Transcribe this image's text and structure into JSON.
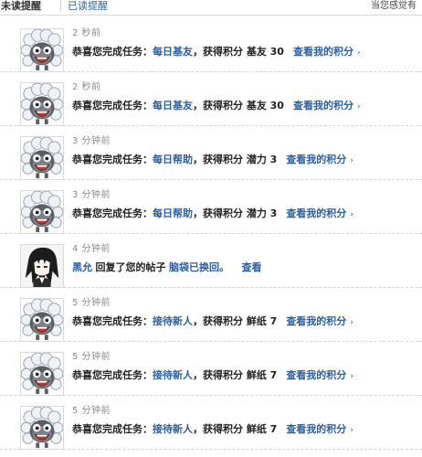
{
  "tabs": {
    "unread_label": "未读提醒",
    "read_label": "已读提醒"
  },
  "top_right_text": "当您感觉有",
  "notifications": [
    {
      "time": "2 秒前",
      "prefix": "恭喜您完成任务：",
      "task": "每日基友",
      "middle": "，获得积分 基友 30",
      "action": "查看我的积分",
      "arrow": "›",
      "avatar": "sheep-avatar-icon"
    },
    {
      "time": "2 秒前",
      "prefix": "恭喜您完成任务：",
      "task": "每日基友",
      "middle": "，获得积分 基友 30",
      "action": "查看我的积分",
      "arrow": "›",
      "avatar": "sheep-avatar-icon"
    },
    {
      "time": "3 分钟前",
      "prefix": "恭喜您完成任务：",
      "task": "每日帮助",
      "middle": "，获得积分 潜力 3",
      "action": "查看我的积分",
      "arrow": "›",
      "avatar": "sheep-avatar-icon"
    },
    {
      "time": "3 分钟前",
      "prefix": "恭喜您完成任务：",
      "task": "每日帮助",
      "middle": "，获得积分 潜力 3",
      "action": "查看我的积分",
      "arrow": "›",
      "avatar": "sheep-avatar-icon"
    },
    {
      "time": "4 分钟前",
      "user": "黑允",
      "reply_text": "回复了您的帖子",
      "post_title": "脑袋已换回。",
      "view_label": "查看",
      "avatar": "anime-character-avatar-icon"
    },
    {
      "time": "5 分钟前",
      "prefix": "恭喜您完成任务：",
      "task": "接待新人",
      "middle": "，获得积分 鲜纸 7",
      "action": "查看我的积分",
      "arrow": "›",
      "avatar": "sheep-avatar-icon"
    },
    {
      "time": "5 分钟前",
      "prefix": "恭喜您完成任务：",
      "task": "接待新人",
      "middle": "，获得积分 鲜纸 7",
      "action": "查看我的积分",
      "arrow": "›",
      "avatar": "sheep-avatar-icon"
    },
    {
      "time": "5 分钟前",
      "prefix": "恭喜您完成任务：",
      "task": "接待新人",
      "middle": "，获得积分 鲜纸 7",
      "action": "查看我的积分",
      "arrow": "›",
      "avatar": "sheep-avatar-icon"
    }
  ]
}
